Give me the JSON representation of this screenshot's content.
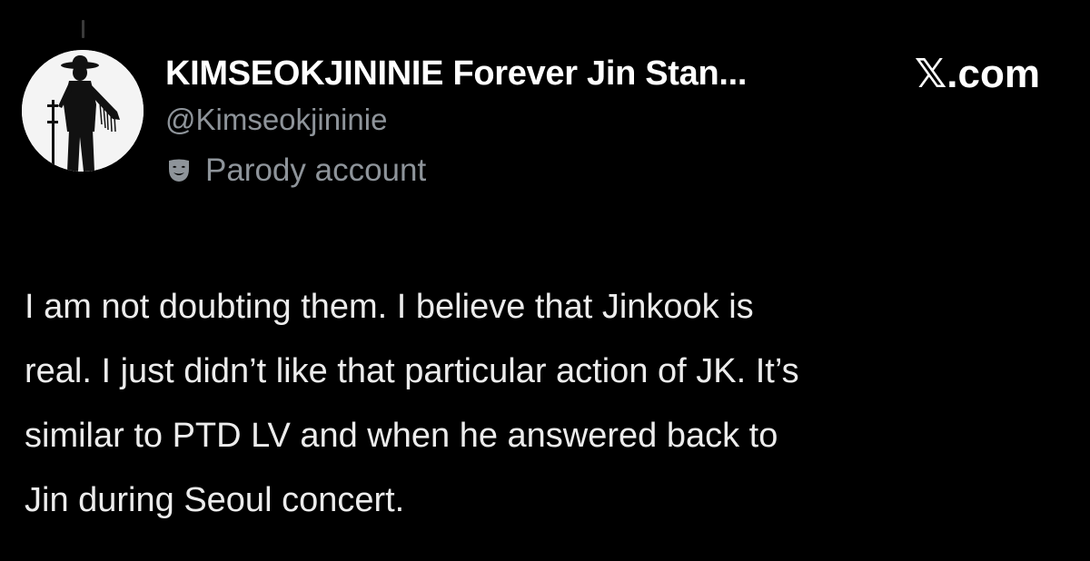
{
  "author": {
    "avatar_icon": "silhouette-with-hat-avatar",
    "display_name": "KIMSEOKJININIE Forever Jin Stan...",
    "handle": "@Kimseokjininie",
    "parody_icon": "theater-mask-icon",
    "parody_label": "Parody account"
  },
  "brand": {
    "label": "𝕏.com"
  },
  "tweet": {
    "lines": [
      "I am not doubting them. I believe that Jinkook is",
      "real. I just didn’t like that particular action of JK. It’s",
      "similar to PTD LV and when he answered back to",
      "Jin during Seoul concert."
    ]
  },
  "colors": {
    "background": "#000000",
    "primary_text": "#ffffff",
    "secondary_text": "#8e949a",
    "body_text": "#ececec"
  }
}
